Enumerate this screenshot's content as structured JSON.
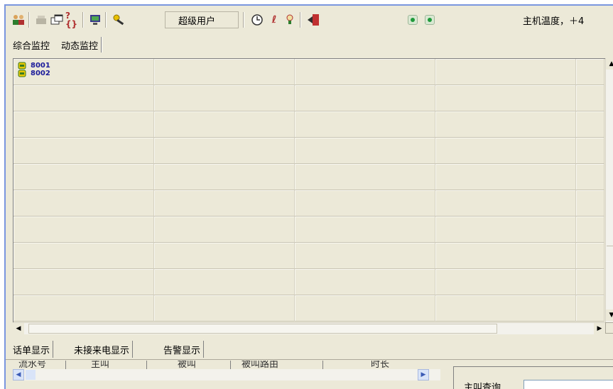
{
  "toolbar": {
    "icons": [
      "group-users-icon",
      "phone-icon",
      "window-icon",
      "help-icon",
      "monitor-icon",
      "key-icon",
      "clock-icon",
      "pen-icon",
      "bulb-icon",
      "exit-icon"
    ],
    "user_label": "超级用户",
    "host_temp_label": "主机温度，＋4"
  },
  "tabs_top": [
    "综合监控",
    "动态监控"
  ],
  "grid": {
    "rows": 10,
    "cols": 5,
    "first_cell_extensions": [
      "8001",
      "8002"
    ]
  },
  "tabs_bottom": [
    "话单显示",
    "未接来电显示",
    "告警显示"
  ],
  "bill_columns": [
    "流水号",
    "主叫",
    "被叫",
    "被叫路由",
    "时长"
  ],
  "query": {
    "label": "主叫查询",
    "value": ""
  },
  "colors": {
    "background": "#ece9d8",
    "window_border": "#7a96df",
    "status_led": "#1f9a3a",
    "extension_text": "#1a1a9a"
  }
}
